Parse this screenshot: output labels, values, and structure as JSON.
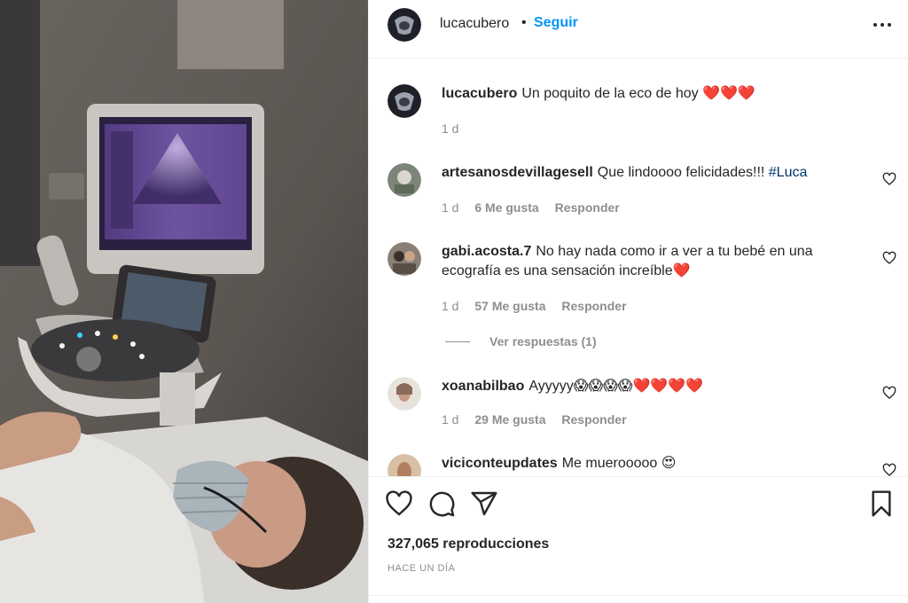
{
  "post": {
    "author": "lucacubero",
    "follow_label": "Seguir",
    "bullet": "•",
    "more_label": "•••",
    "caption": {
      "username": "lucacubero",
      "text": "Un poquito de la eco de hoy ❤️❤️❤️",
      "time": "1 d"
    },
    "comments": [
      {
        "username": "artesanosdevillagesell",
        "text": "Que lindoooo felicidades!!! ",
        "hashtag": "#Luca",
        "time": "1 d",
        "likes": "6 Me gusta",
        "reply": "Responder"
      },
      {
        "username": "gabi.acosta.7",
        "text": "No hay nada como ir a ver a tu bebé en una ecografía es una sensación increíble❤️",
        "time": "1 d",
        "likes": "57 Me gusta",
        "reply": "Responder",
        "view_replies": "Ver respuestas (1)"
      },
      {
        "username": "xoanabilbao",
        "text": "Ayyyyy😱😱😱😱❤️❤️❤️❤️",
        "time": "1 d",
        "likes": "29 Me gusta",
        "reply": "Responder"
      },
      {
        "username": "viciconteupdates",
        "text": "Me muerooooo 😍"
      }
    ],
    "views": "327,065 reproducciones",
    "posted_ago": "HACE UN DÍA"
  },
  "icons": {
    "like": "heart-icon",
    "comment": "comment-icon",
    "share": "paper-plane-icon",
    "save": "bookmark-icon",
    "more": "more-options-icon"
  },
  "colors": {
    "follow": "#0095f6",
    "muted": "#8e8e8e",
    "hashtag": "#00376b",
    "text": "#262626"
  }
}
